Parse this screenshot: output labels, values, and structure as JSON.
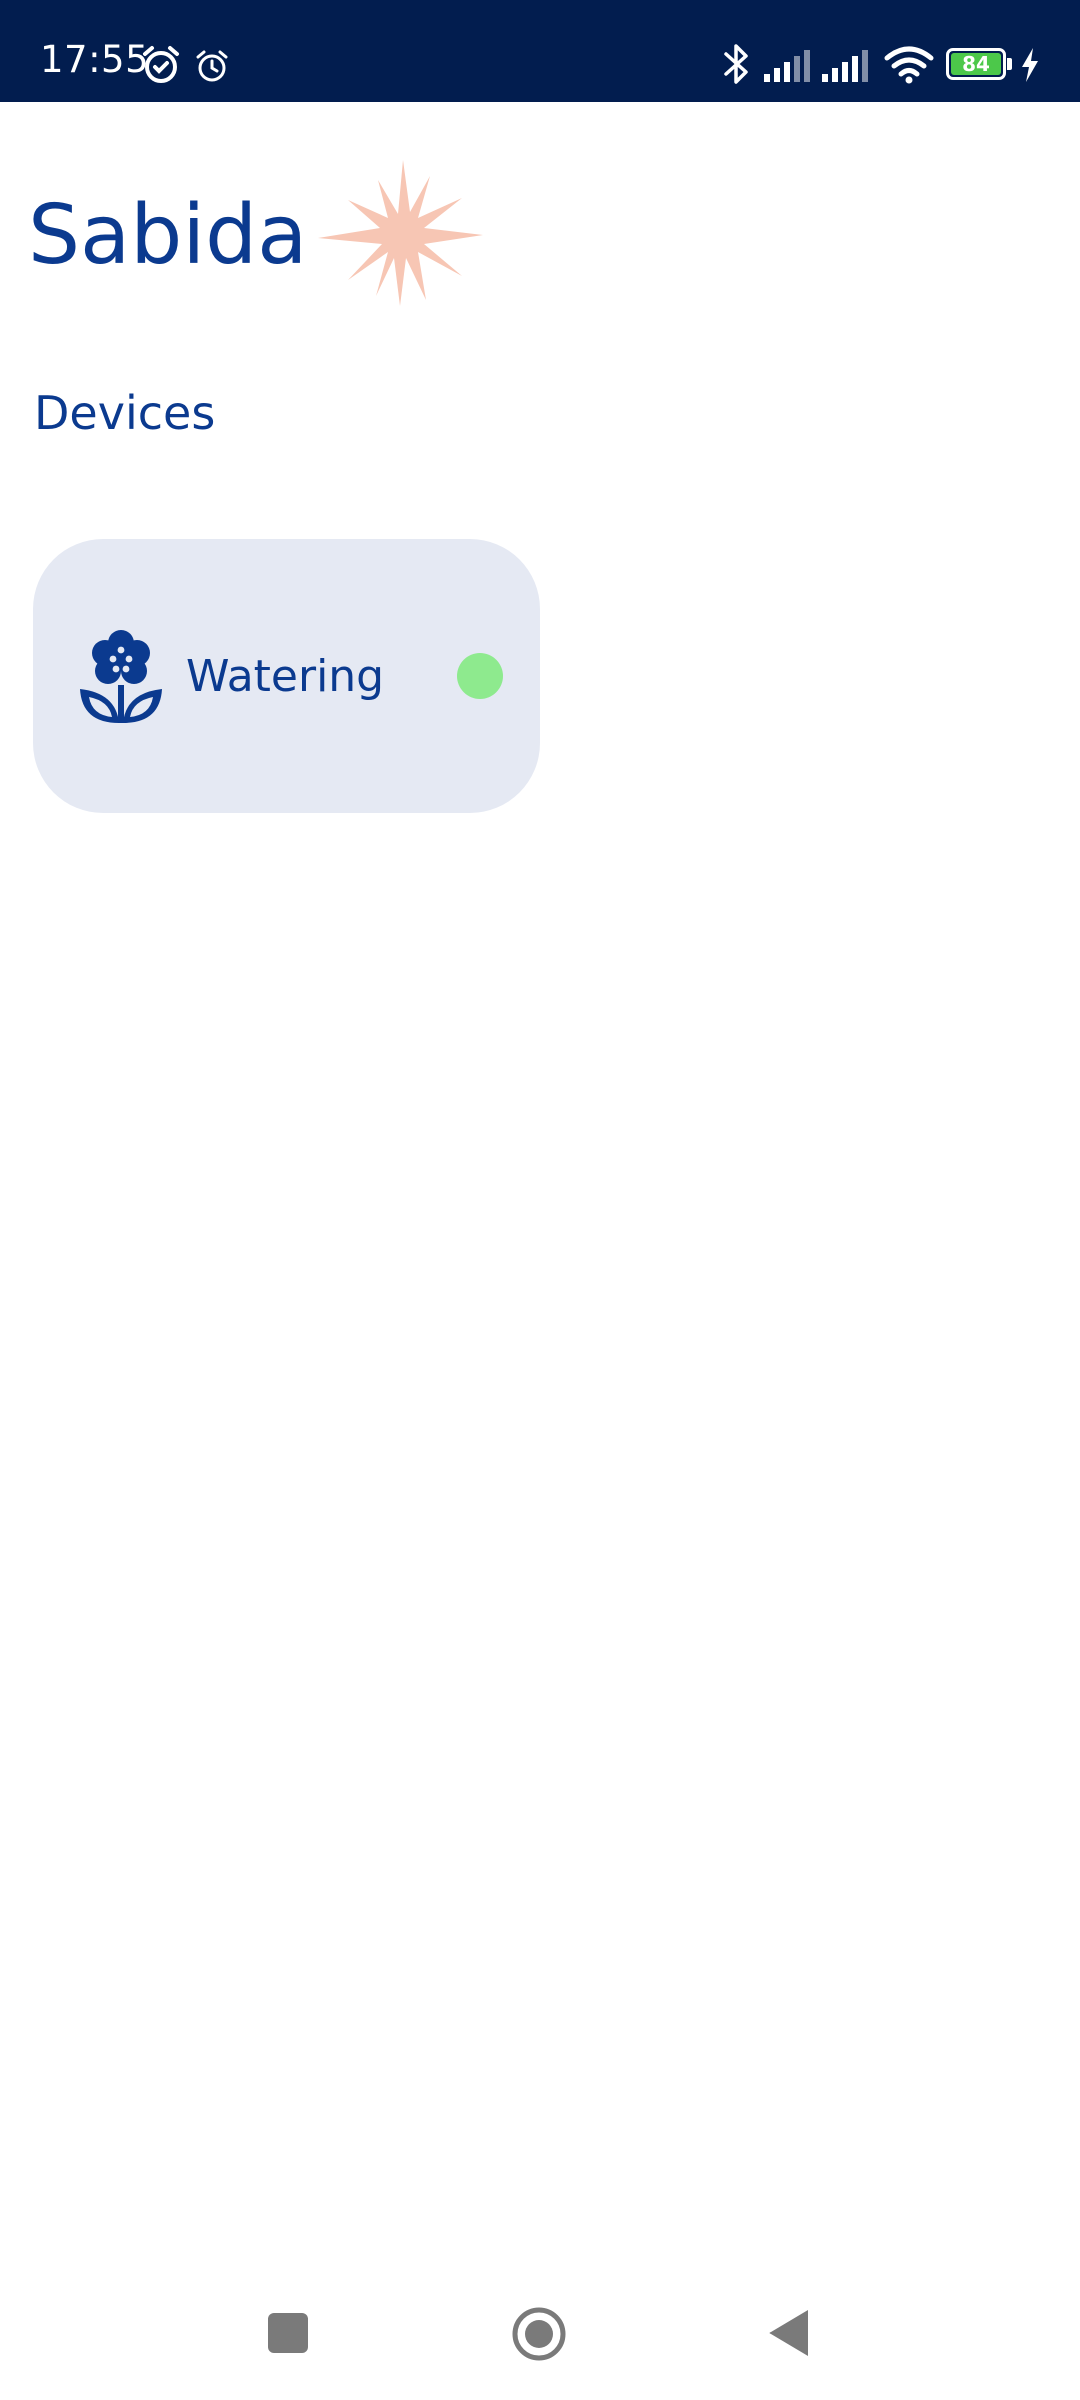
{
  "status_bar": {
    "time": "17:55",
    "battery_level": "84",
    "icons": [
      "alarm-icon",
      "alarm-outline-icon",
      "bluetooth-icon",
      "signal-icon",
      "signal-icon",
      "wifi-icon",
      "battery-icon",
      "charging-icon"
    ]
  },
  "header": {
    "app_title": "Sabida",
    "decoration_icon": "sparkle-icon"
  },
  "devices_section": {
    "title": "Devices",
    "devices": [
      {
        "label": "Watering",
        "icon": "flower-icon",
        "status": "online",
        "status_color": "#8eea8e"
      }
    ]
  },
  "nav_bar": {
    "buttons": [
      "recents-button",
      "home-button",
      "back-button"
    ]
  },
  "colors": {
    "brand_blue": "#0b3a8f",
    "status_bar_bg": "#021d4f",
    "card_bg": "#e5e9f3",
    "sparkle": "#f7c6b4",
    "nav_icon": "#7a7a7a"
  }
}
